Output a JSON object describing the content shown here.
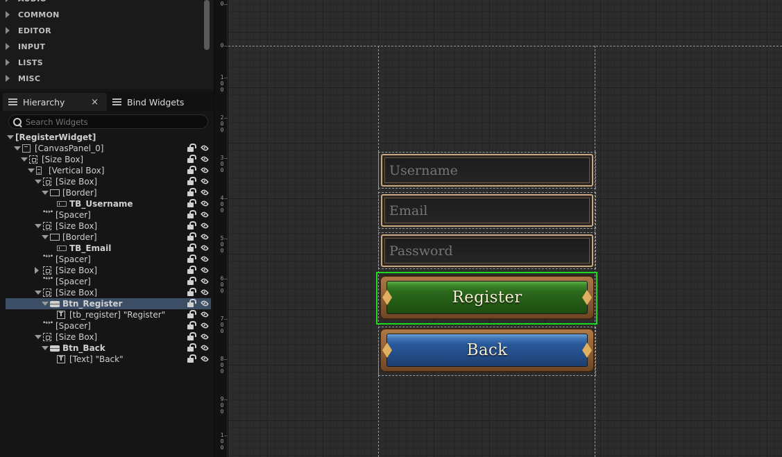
{
  "palette": {
    "categories": [
      "AUDIO",
      "COMMON",
      "EDITOR",
      "INPUT",
      "LISTS",
      "MISC"
    ]
  },
  "tabs": {
    "hierarchy": "Hierarchy",
    "close": "×",
    "bind_widgets": "Bind Widgets"
  },
  "search": {
    "placeholder": "Search Widgets"
  },
  "tree": [
    {
      "label": "[RegisterWidget]",
      "depth": 0,
      "icon": "none",
      "expand": "open",
      "bold": true
    },
    {
      "label": "[CanvasPanel_0]",
      "depth": 1,
      "icon": "canvas",
      "expand": "open",
      "bold": false
    },
    {
      "label": "[Size Box]",
      "depth": 2,
      "icon": "sizebox",
      "expand": "open",
      "bold": false
    },
    {
      "label": "[Vertical Box]",
      "depth": 3,
      "icon": "vbox",
      "expand": "open",
      "bold": false
    },
    {
      "label": "[Size Box]",
      "depth": 4,
      "icon": "sizebox",
      "expand": "open",
      "bold": false
    },
    {
      "label": "[Border]",
      "depth": 5,
      "icon": "border",
      "expand": "open",
      "bold": false
    },
    {
      "label": "TB_Username",
      "depth": 6,
      "icon": "textbox",
      "expand": "none",
      "bold": true
    },
    {
      "label": "[Spacer]",
      "depth": 4,
      "icon": "spacer",
      "expand": "none",
      "bold": false
    },
    {
      "label": "[Size Box]",
      "depth": 4,
      "icon": "sizebox",
      "expand": "open",
      "bold": false
    },
    {
      "label": "[Border]",
      "depth": 5,
      "icon": "border",
      "expand": "open",
      "bold": false
    },
    {
      "label": "TB_Email",
      "depth": 6,
      "icon": "textbox",
      "expand": "none",
      "bold": true
    },
    {
      "label": "[Spacer]",
      "depth": 4,
      "icon": "spacer",
      "expand": "none",
      "bold": false
    },
    {
      "label": "[Size Box]",
      "depth": 4,
      "icon": "sizebox",
      "expand": "closed",
      "bold": false
    },
    {
      "label": "[Spacer]",
      "depth": 4,
      "icon": "spacer",
      "expand": "none",
      "bold": false
    },
    {
      "label": "[Size Box]",
      "depth": 4,
      "icon": "sizebox",
      "expand": "open",
      "bold": false
    },
    {
      "label": "Btn_Register",
      "depth": 5,
      "icon": "button",
      "expand": "open",
      "bold": true,
      "selected": true
    },
    {
      "label": "[tb_register] \"Register\"",
      "depth": 6,
      "icon": "text",
      "expand": "none",
      "bold": false
    },
    {
      "label": "[Spacer]",
      "depth": 4,
      "icon": "spacer",
      "expand": "none",
      "bold": false
    },
    {
      "label": "[Size Box]",
      "depth": 4,
      "icon": "sizebox",
      "expand": "open",
      "bold": false
    },
    {
      "label": "Btn_Back",
      "depth": 5,
      "icon": "button",
      "expand": "open",
      "bold": true
    },
    {
      "label": "[Text] \"Back\"",
      "depth": 6,
      "icon": "text",
      "expand": "none",
      "bold": false
    }
  ],
  "ruler": {
    "labels": [
      [
        "0"
      ],
      [
        "0"
      ],
      [
        "1",
        "0",
        "0"
      ],
      [
        "2",
        "0",
        "0"
      ],
      [
        "3",
        "0",
        "0"
      ],
      [
        "4",
        "0",
        "0"
      ],
      [
        "5",
        "0",
        "0"
      ],
      [
        "6",
        "0",
        "0"
      ],
      [
        "7",
        "0",
        "0"
      ],
      [
        "8",
        "0",
        "0"
      ],
      [
        "9",
        "0",
        "0"
      ],
      [
        "1",
        "0",
        "0"
      ]
    ]
  },
  "form": {
    "username_placeholder": "Username",
    "email_placeholder": "Email",
    "password_placeholder": "Password",
    "register_label": "Register",
    "back_label": "Back"
  },
  "colors": {
    "selection": "#3c4d66",
    "selection_frame": "#1fd81f",
    "register_green": "#2c6a1c",
    "back_blue": "#28589a",
    "field_border": "#c9a981"
  }
}
